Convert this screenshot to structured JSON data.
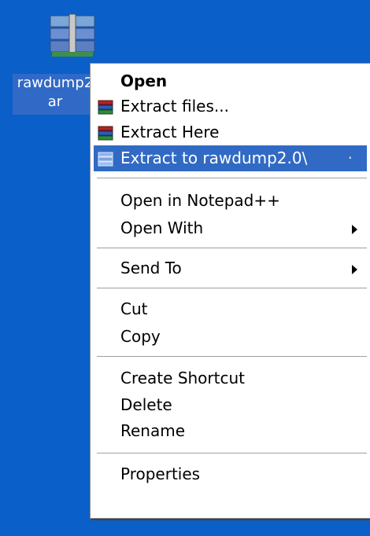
{
  "desktop": {
    "file": {
      "label_line1": "rawdump2",
      "label_line2": "ar",
      "icon": "winrar-archive-icon"
    }
  },
  "context_menu": {
    "open": "Open",
    "extract_files": "Extract files...",
    "extract_here": "Extract Here",
    "extract_to": "Extract to rawdump2.0\\",
    "open_in_notepad": "Open in Notepad++",
    "open_with": "Open With",
    "send_to": "Send To",
    "cut": "Cut",
    "copy": "Copy",
    "create_shortcut": "Create Shortcut",
    "delete": "Delete",
    "rename": "Rename",
    "properties": "Properties",
    "highlighted_item": "Extract to rawdump2.0\\"
  },
  "colors": {
    "desktop_bg": "#0b5fc9",
    "selection": "#316ac5",
    "menu_bg": "#ffffff"
  }
}
